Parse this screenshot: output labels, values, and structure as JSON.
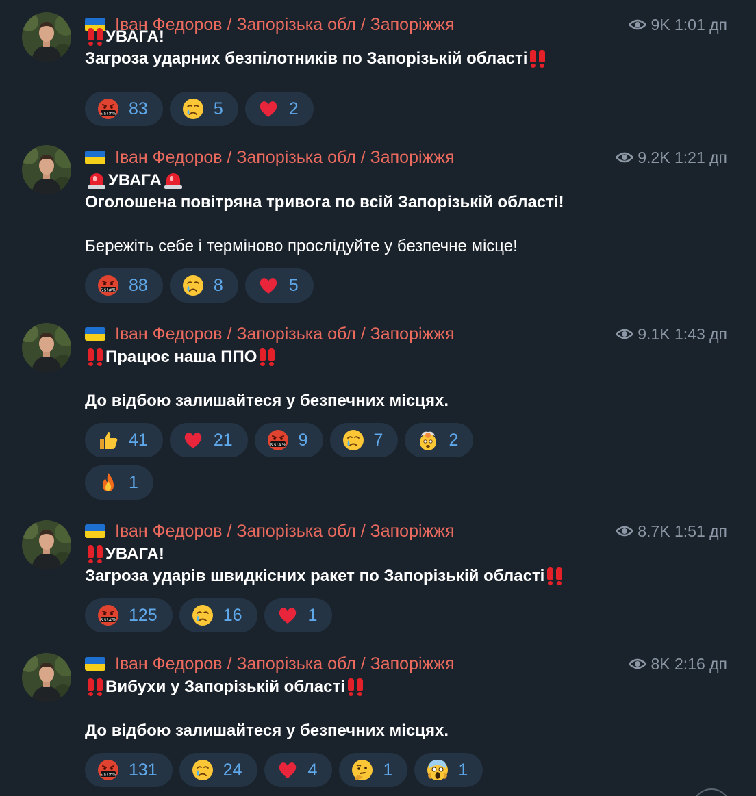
{
  "channel": {
    "author": "Іван Федоров / Запорізька обл / Запоріжжя",
    "author_color": "#ea6a5e",
    "accent": "#5fa8ea",
    "background": "#1a222c",
    "pill_background": "#243444"
  },
  "messages": [
    {
      "views": "9K",
      "time": "1:01 дп",
      "lines": [
        {
          "prefix": "bang",
          "text": "УВАГА!",
          "suffix": ""
        },
        {
          "prefix": "",
          "text": "Загроза ударних безпілотників по Запорізькій області",
          "suffix": "bang"
        }
      ],
      "reactions": [
        {
          "icon": "cursing-face-icon",
          "count": "83"
        },
        {
          "icon": "crying-face-icon",
          "count": "5"
        },
        {
          "icon": "red-heart-icon",
          "count": "2"
        }
      ]
    },
    {
      "views": "9.2K",
      "time": "1:21 дп",
      "lines": [
        {
          "prefix": "siren",
          "text": "УВАГА",
          "suffix": "siren"
        },
        {
          "prefix": "",
          "text": "Оголошена повітряна тривога по всій Запорізькій області!",
          "suffix": ""
        },
        {
          "prefix": "",
          "text": "",
          "suffix": ""
        },
        {
          "prefix": "",
          "text": "Бережіть себе і терміново прослідуйте у безпечне місце!",
          "suffix": "",
          "weight": "normal"
        }
      ],
      "reactions": [
        {
          "icon": "cursing-face-icon",
          "count": "88"
        },
        {
          "icon": "crying-face-icon",
          "count": "8"
        },
        {
          "icon": "red-heart-icon",
          "count": "5"
        }
      ]
    },
    {
      "views": "9.1K",
      "time": "1:43 дп",
      "lines": [
        {
          "prefix": "bang",
          "text": "Працює наша ППО",
          "suffix": "bang"
        },
        {
          "prefix": "",
          "text": "",
          "suffix": ""
        },
        {
          "prefix": "",
          "text": "До відбою залишайтеся у безпечних місцях.",
          "suffix": ""
        }
      ],
      "reactions": [
        {
          "icon": "thumbs-up-icon",
          "count": "41"
        },
        {
          "icon": "red-heart-icon",
          "count": "21"
        },
        {
          "icon": "cursing-face-icon",
          "count": "9"
        },
        {
          "icon": "crying-face-icon",
          "count": "7"
        },
        {
          "icon": "exploding-head-icon",
          "count": "2"
        },
        {
          "icon": "fire-icon",
          "count": "1"
        }
      ]
    },
    {
      "views": "8.7K",
      "time": "1:51 дп",
      "lines": [
        {
          "prefix": "bang",
          "text": "УВАГА!",
          "suffix": ""
        },
        {
          "prefix": "",
          "text": "Загроза ударів швидкісних ракет по Запорізькій області",
          "suffix": "bang"
        }
      ],
      "reactions": [
        {
          "icon": "cursing-face-icon",
          "count": "125"
        },
        {
          "icon": "crying-face-icon",
          "count": "16"
        },
        {
          "icon": "red-heart-icon",
          "count": "1"
        }
      ]
    },
    {
      "views": "8K",
      "time": "2:16 дп",
      "lines": [
        {
          "prefix": "bang",
          "text": "Вибухи у Запорізькій області",
          "suffix": "bang"
        },
        {
          "prefix": "",
          "text": "",
          "suffix": ""
        },
        {
          "prefix": "",
          "text": "До відбою залишайтеся у безпечних місцях.",
          "suffix": ""
        }
      ],
      "reactions": [
        {
          "icon": "cursing-face-icon",
          "count": "131"
        },
        {
          "icon": "crying-face-icon",
          "count": "24"
        },
        {
          "icon": "red-heart-icon",
          "count": "4"
        },
        {
          "icon": "thinking-face-icon",
          "count": "1"
        },
        {
          "icon": "screaming-face-icon",
          "count": "1"
        }
      ]
    }
  ]
}
